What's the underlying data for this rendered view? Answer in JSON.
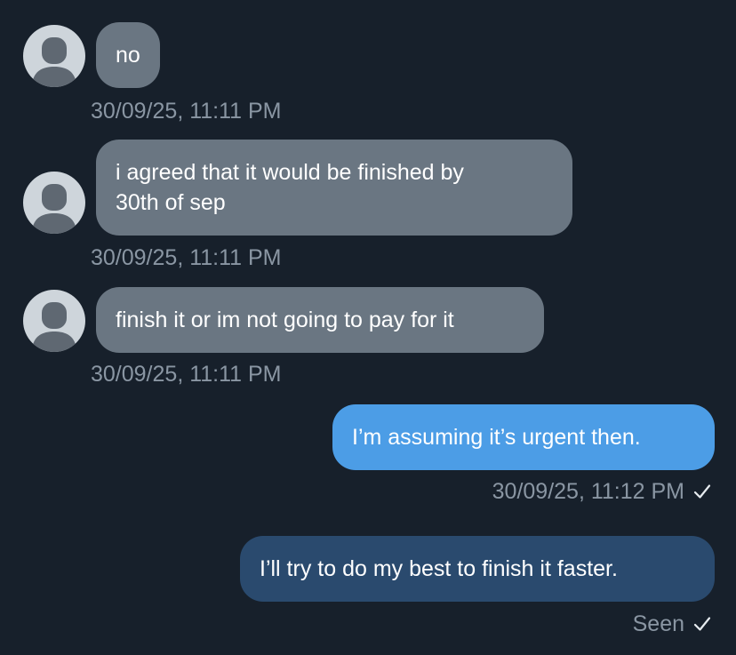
{
  "conversation": {
    "messages": [
      {
        "direction": "incoming",
        "text": "no",
        "timestamp": "30/09/25, 11:11 PM"
      },
      {
        "direction": "incoming",
        "text_line1": "i agreed that it would be finished by",
        "text_line2": "30th of sep",
        "timestamp": "30/09/25, 11:11 PM"
      },
      {
        "direction": "incoming",
        "text": "finish it or im not going to pay for it",
        "timestamp": "30/09/25, 11:11 PM"
      },
      {
        "direction": "outgoing",
        "text": "I’m assuming it’s urgent then.",
        "timestamp": "30/09/25, 11:12 PM"
      },
      {
        "direction": "outgoing",
        "text": "I’ll try to do my best to finish it faster.",
        "status": "Seen"
      }
    ]
  },
  "colors": {
    "background": "#17202b",
    "incoming_bubble": "#6a7682",
    "outgoing_bubble_sent": "#4c9de6",
    "outgoing_bubble_seen": "#2a4a6e",
    "timestamp_text": "#8a96a3",
    "avatar": "#ced5db"
  },
  "icons": {
    "avatar": "default-user-avatar-icon",
    "read_receipt": "checkmark-icon"
  }
}
